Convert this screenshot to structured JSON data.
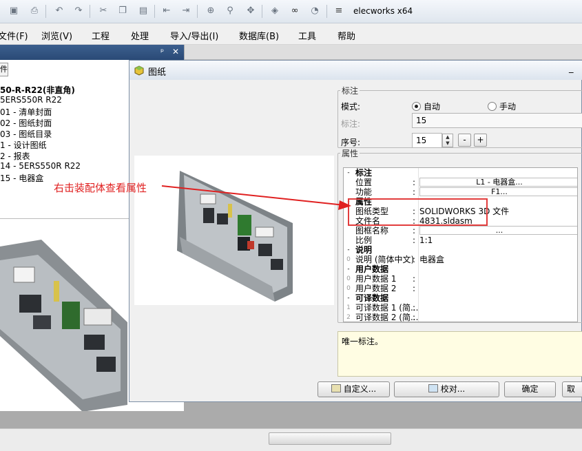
{
  "app": {
    "title": "elecworks x64"
  },
  "toolbar": {
    "icons": [
      "save-icon",
      "print-preview-icon",
      "undo-icon",
      "redo-icon",
      "cut-icon",
      "copy-icon",
      "paste-icon",
      "back-icon",
      "forward-icon",
      "zoom-window-icon",
      "zoom-icon",
      "pan-icon",
      "mirror-icon",
      "binoculars-icon",
      "refresh-icon"
    ]
  },
  "menu": [
    "文件(F)",
    "浏览(V)",
    "工程",
    "处理",
    "导入/导出(I)",
    "数据库(B)",
    "工具",
    "帮助"
  ],
  "left_pane": {
    "pin": "ᵖ",
    "close": "✕",
    "tab_label": "件",
    "tree": [
      "50-R-R22(非直角)",
      "5ERS550R R22",
      "01 - 清单封面",
      "02 - 图纸封面",
      "03 - 图纸目录",
      "1 - 设计图纸",
      "2 - 报表",
      "14 - 5ERS550R R22",
      "15 - 电器盒"
    ]
  },
  "annotation": {
    "text": "右击装配体查看属性",
    "color": "#e02020"
  },
  "dialog": {
    "title": "图纸",
    "minimize": "_",
    "group_mark": {
      "legend": "标注",
      "mode_label": "模式:",
      "mode_auto": "自动",
      "mode_manual": "手动",
      "mark_label": "标注:",
      "mark_value": "15",
      "seq_label": "序号:",
      "seq_value": "15",
      "minus": "-",
      "plus": "+"
    },
    "group_props": {
      "legend": "属性",
      "rows": [
        {
          "kind": "cat",
          "gutter": "-",
          "key": "标注"
        },
        {
          "kind": "prop",
          "gutter": "",
          "key": "位置",
          "value": "L1 - 电器盒...",
          "boxed": true
        },
        {
          "kind": "prop",
          "gutter": "",
          "key": "功能",
          "value": "F1...",
          "boxed": true
        },
        {
          "kind": "cat",
          "gutter": "-",
          "key": "属性"
        },
        {
          "kind": "prop",
          "gutter": "",
          "key": "图纸类型",
          "value": "SOLIDWORKS 3D 文件"
        },
        {
          "kind": "prop",
          "gutter": "",
          "key": "文件名",
          "value": "4831.sldasm"
        },
        {
          "kind": "prop",
          "gutter": "",
          "key": "图框名称",
          "value": "...",
          "boxed": true
        },
        {
          "kind": "prop",
          "gutter": "",
          "key": "比例",
          "value": "1:1"
        },
        {
          "kind": "cat",
          "gutter": "-",
          "key": "说明"
        },
        {
          "kind": "prop",
          "gutter": "0",
          "key": "说明 (简体中文)",
          "value": "电器盒"
        },
        {
          "kind": "cat",
          "gutter": "-",
          "key": "用户数据"
        },
        {
          "kind": "prop",
          "gutter": "0",
          "key": "用户数据 1",
          "value": ""
        },
        {
          "kind": "prop",
          "gutter": "0",
          "key": "用户数据 2",
          "value": ""
        },
        {
          "kind": "cat",
          "gutter": "-",
          "key": "可译数据"
        },
        {
          "kind": "prop",
          "gutter": "1",
          "key": "可译数据 1 (简...",
          "value": ""
        },
        {
          "kind": "prop",
          "gutter": "2",
          "key": "可译数据 2 (简...",
          "value": ""
        }
      ]
    },
    "description": "唯一标注。",
    "buttons": {
      "customize": "自定义...",
      "check": "校对...",
      "ok": "确定",
      "cancel": "取"
    }
  }
}
